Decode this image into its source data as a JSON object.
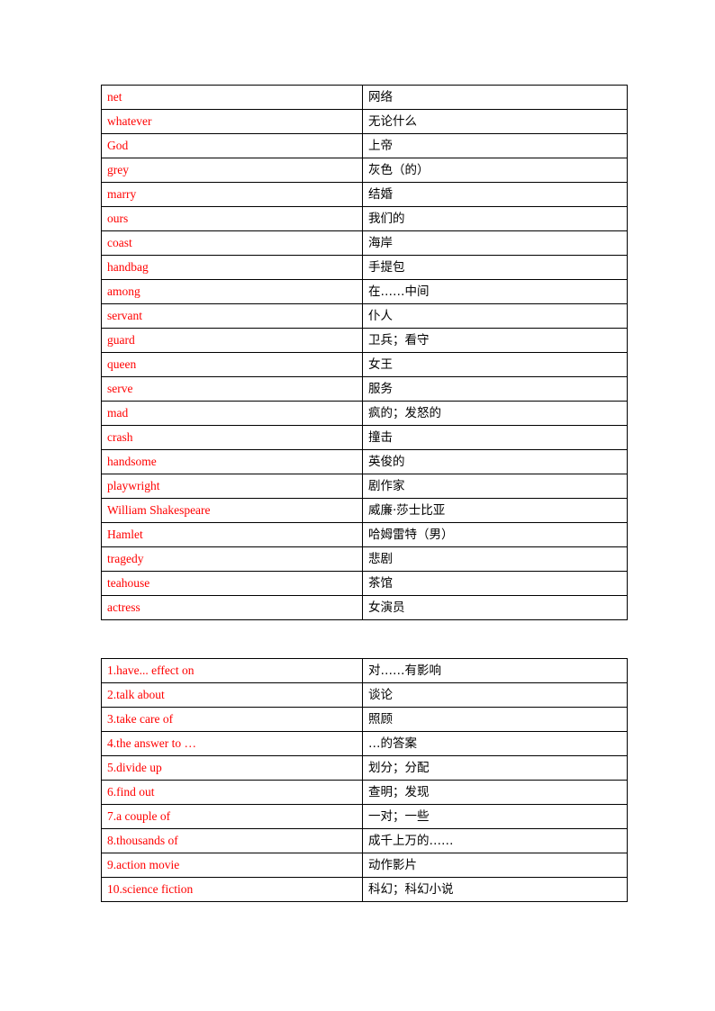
{
  "colors": {
    "english_text": "#FF0000",
    "chinese_text": "#000000",
    "table_border": "#000000",
    "page_background": "#FFFFFF"
  },
  "words_table": {
    "name": "vocabulary-words-table",
    "rows": [
      {
        "english": "net",
        "chinese": "网络"
      },
      {
        "english": "whatever",
        "chinese": "无论什么"
      },
      {
        "english": "God",
        "chinese": "上帝"
      },
      {
        "english": "grey",
        "chinese": "灰色（的）"
      },
      {
        "english": "marry",
        "chinese": "结婚"
      },
      {
        "english": "ours",
        "chinese": "我们的"
      },
      {
        "english": "coast",
        "chinese": "海岸"
      },
      {
        "english": "handbag",
        "chinese": "手提包"
      },
      {
        "english": "among",
        "chinese": "在……中间"
      },
      {
        "english": "servant",
        "chinese": "仆人"
      },
      {
        "english": "guard",
        "chinese": "卫兵；看守"
      },
      {
        "english": "queen",
        "chinese": "女王"
      },
      {
        "english": "serve",
        "chinese": "服务"
      },
      {
        "english": "mad",
        "chinese": "疯的；发怒的"
      },
      {
        "english": "crash",
        "chinese": "撞击"
      },
      {
        "english": "handsome",
        "chinese": "英俊的"
      },
      {
        "english": "playwright",
        "chinese": "剧作家"
      },
      {
        "english": "William Shakespeare",
        "chinese": "威廉·莎士比亚"
      },
      {
        "english": "Hamlet",
        "chinese": "哈姆雷特（男）"
      },
      {
        "english": "tragedy",
        "chinese": "悲剧"
      },
      {
        "english": "teahouse",
        "chinese": "茶馆"
      },
      {
        "english": "actress",
        "chinese": "女演员"
      }
    ]
  },
  "phrases_table": {
    "name": "vocabulary-phrases-table",
    "rows": [
      {
        "english": "1.have... effect on",
        "chinese": "对……有影响"
      },
      {
        "english": "2.talk about",
        "chinese": "谈论"
      },
      {
        "english": "3.take care of",
        "chinese": " 照顾"
      },
      {
        "english": "4.the answer to …",
        "chinese": "…的答案"
      },
      {
        "english": "5.divide up",
        "chinese": "划分；分配"
      },
      {
        "english": "6.find out",
        "chinese": "查明；发现"
      },
      {
        "english": "7.a couple of",
        "chinese": "一对；一些"
      },
      {
        "english": "8.thousands of",
        "chinese": "成千上万的……"
      },
      {
        "english": "9.action movie",
        "chinese": "动作影片"
      },
      {
        "english": "10.science fiction",
        "chinese": " 科幻；科幻小说"
      }
    ]
  }
}
